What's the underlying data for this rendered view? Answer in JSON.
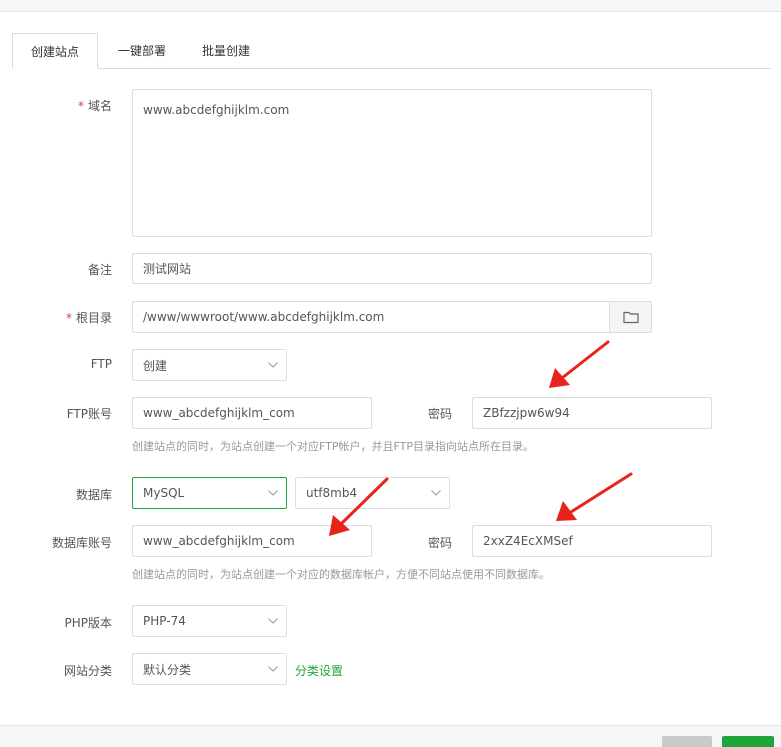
{
  "tabs": [
    "创建站点",
    "一键部署",
    "批量创建"
  ],
  "form": {
    "domain": {
      "label": "域名",
      "required": "*",
      "value": "www.abcdefghijklm.com"
    },
    "remark": {
      "label": "备注",
      "value": "测试网站"
    },
    "root": {
      "label": "根目录",
      "required": "*",
      "value": "/www/wwwroot/www.abcdefghijklm.com"
    },
    "ftp": {
      "label": "FTP",
      "value": "创建"
    },
    "ftp_account": {
      "label": "FTP账号",
      "value": "www_abcdefghijklm_com",
      "password_label": "密码",
      "password": "ZBfzzjpw6w94",
      "help": "创建站点的同时，为站点创建一个对应FTP帐户，并且FTP目录指向站点所在目录。"
    },
    "database": {
      "label": "数据库",
      "value": "MySQL",
      "charset": "utf8mb4"
    },
    "db_account": {
      "label": "数据库账号",
      "value": "www_abcdefghijklm_com",
      "password_label": "密码",
      "password": "2xxZ4EcXMSef",
      "help": "创建站点的同时，为站点创建一个对应的数据库帐户，方便不同站点使用不同数据库。"
    },
    "php": {
      "label": "PHP版本",
      "value": "PHP-74"
    },
    "category": {
      "label": "网站分类",
      "value": "默认分类",
      "link": "分类设置"
    }
  },
  "colors": {
    "accent": "#20a53a",
    "required": "#e4393c",
    "arrow": "#e8231b"
  },
  "icons": {
    "folder": "folder-icon",
    "chevron": "chevron-down-icon"
  }
}
